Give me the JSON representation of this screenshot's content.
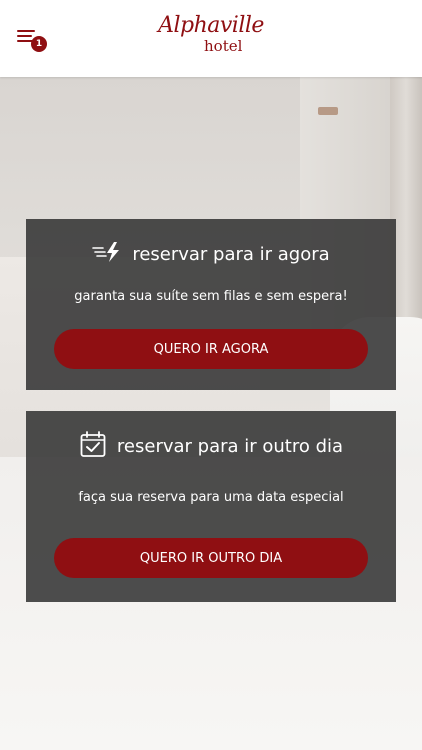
{
  "header": {
    "brand_name": "Alphaville",
    "brand_sub": "hotel",
    "menu_badge": "1",
    "menu_icon": "hamburger-menu-icon"
  },
  "cards": [
    {
      "icon": "lightning-fast-icon",
      "title": "reservar para ir agora",
      "subtitle": "garanta sua suíte sem filas e sem espera!",
      "button_label": "QUERO IR AGORA"
    },
    {
      "icon": "calendar-check-icon",
      "title": "reservar para ir outro dia",
      "subtitle": "faça sua reserva para uma data especial",
      "button_label": "QUERO IR OUTRO DIA"
    }
  ],
  "colors": {
    "brand": "#8f0f12",
    "card_bg": "#343434",
    "header_bg": "#ffffff",
    "text_light": "#ffffff"
  }
}
